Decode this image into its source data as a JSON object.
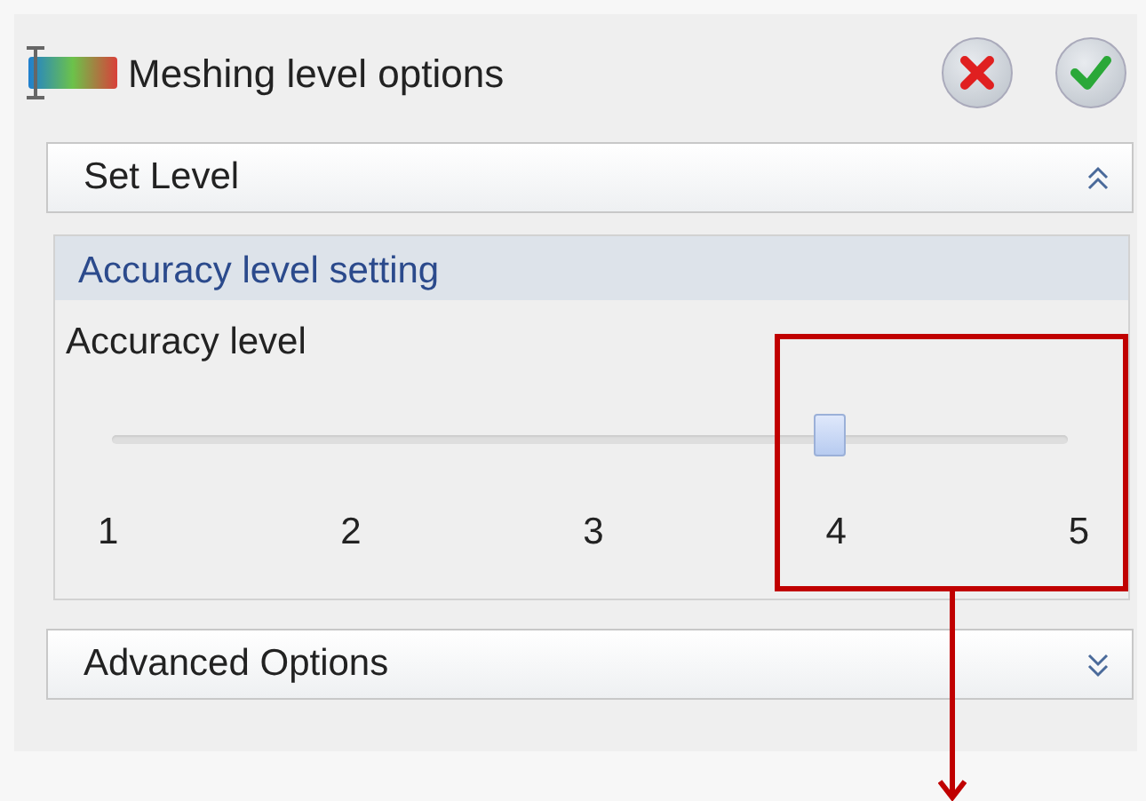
{
  "window": {
    "title": "Meshing level options"
  },
  "buttons": [
    {
      "kind": "cancel"
    },
    {
      "kind": "confirm"
    }
  ],
  "sections": [
    {
      "title": "Set Level",
      "expanded": true,
      "group": {
        "title": "Accuracy level setting",
        "slider": {
          "label": "Accuracy level",
          "level": 0.75,
          "ticks": [
            "1",
            "2",
            "3",
            "4",
            "5"
          ]
        }
      }
    },
    {
      "title": "Advanced Options",
      "expanded": false
    }
  ]
}
